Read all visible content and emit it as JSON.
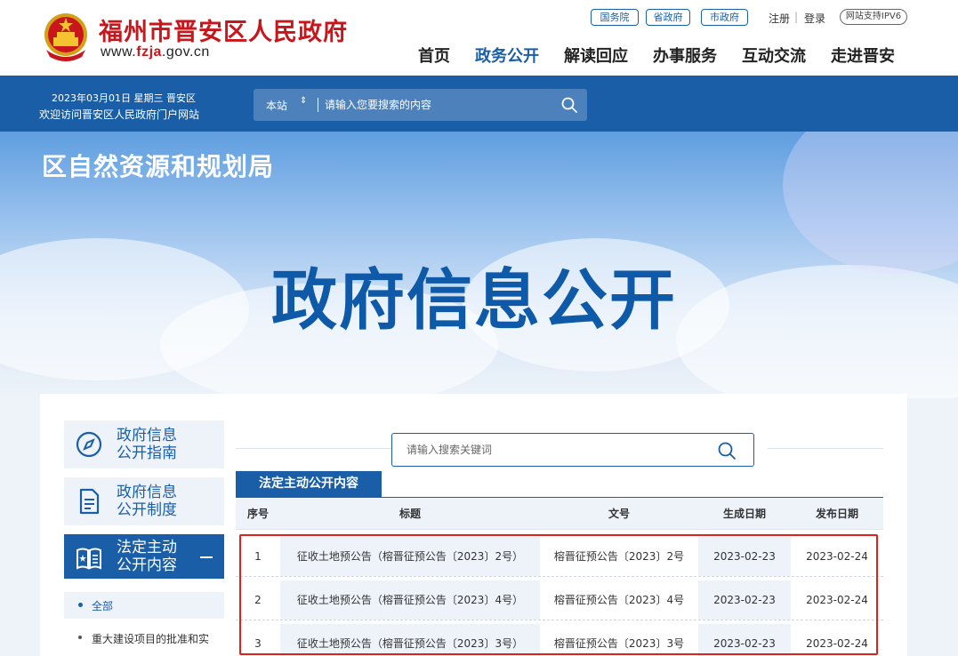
{
  "header": {
    "site_title": "福州市晋安区人民政府",
    "domain_prefix": "www.",
    "domain_highlight": "fzja",
    "domain_suffix": ".gov.cn",
    "top_links": {
      "state_council": "国务院",
      "province": "省政府",
      "city": "市政府"
    },
    "register": "注册",
    "separator": "|",
    "login": "登录",
    "ipv6": "网站支持IPV6",
    "nav": [
      "首页",
      "政务公开",
      "解读回应",
      "办事服务",
      "互动交流",
      "走进晋安"
    ],
    "active_nav_index": 1
  },
  "bluebar": {
    "date_line": "2023年03月01日 星期三 晋安区",
    "welcome": "欢迎访问晋安区人民政府门户网站",
    "scope": "本站",
    "scope_arrow": "⇕",
    "search_placeholder": "请输入您要搜索的内容"
  },
  "banner": {
    "department": "区自然资源和规划局",
    "title": "政府信息公开"
  },
  "sidebar": {
    "guide_label": "政府信息\n公开指南",
    "system_label": "政府信息\n公开制度",
    "content_label": "法定主动\n公开内容",
    "sub_all": "全部",
    "sub_major": "重大建设项目的批准和实"
  },
  "search": {
    "placeholder": "请输入搜索关键词"
  },
  "tab": {
    "label": "法定主动公开内容"
  },
  "table": {
    "headers": [
      "序号",
      "标题",
      "文号",
      "生成日期",
      "发布日期"
    ],
    "rows": [
      [
        "1",
        "征收土地预公告（榕晋征预公告〔2023〕2号）",
        "榕晋征预公告〔2023〕2号",
        "2023-02-23",
        "2023-02-24"
      ],
      [
        "2",
        "征收土地预公告（榕晋征预公告〔2023〕4号）",
        "榕晋征预公告〔2023〕4号",
        "2023-02-23",
        "2023-02-24"
      ],
      [
        "3",
        "征收土地预公告（榕晋征预公告〔2023〕3号）",
        "榕晋征预公告〔2023〕3号",
        "2023-02-23",
        "2023-02-24"
      ]
    ]
  },
  "colors": {
    "brand_blue": "#1a5ea8",
    "title_red": "#c8161d",
    "highlight_red": "#e0211a"
  },
  "icons": {
    "emblem": "national-emblem-icon",
    "search": "search-icon",
    "guide": "compass-icon",
    "system": "document-icon",
    "content": "book-star-icon",
    "collapse": "minus-icon"
  }
}
